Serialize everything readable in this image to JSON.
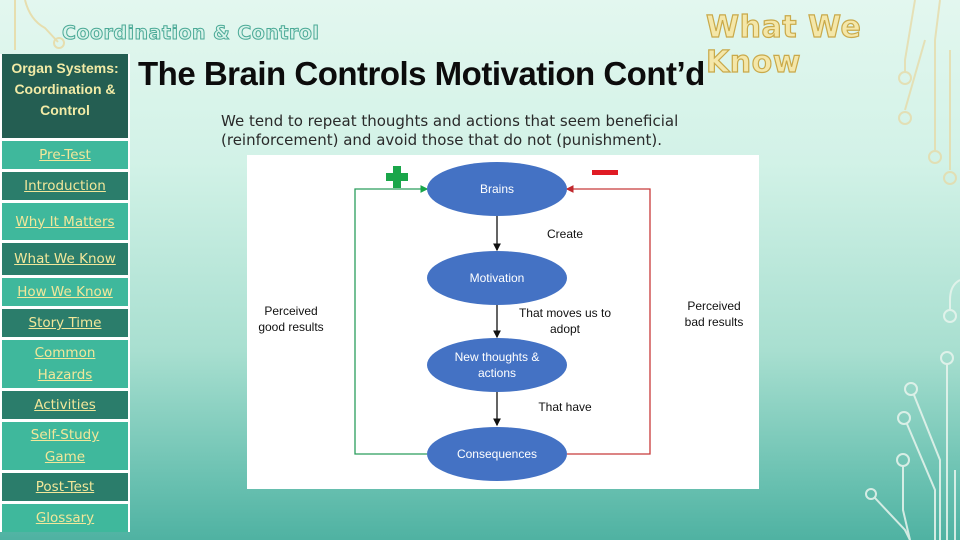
{
  "header": {
    "section_title": "Coordination & Control",
    "topic_title": "What We Know"
  },
  "sidebar": {
    "heading": "Organ Systems: Coordination & Control",
    "items": [
      {
        "label": "Pre-Test"
      },
      {
        "label": "Introduction"
      },
      {
        "label": "Why It Matters"
      },
      {
        "label": "What We Know"
      },
      {
        "label": "How We Know"
      },
      {
        "label": "Story Time"
      },
      {
        "label": "Common Hazards"
      },
      {
        "label": "Activities"
      },
      {
        "label": "Self-Study Game"
      },
      {
        "label": "Post-Test"
      },
      {
        "label": "Glossary"
      }
    ]
  },
  "main": {
    "title": "The Brain Controls Motivation Cont’d",
    "intro_line1": "We tend to repeat thoughts and actions that seem beneficial",
    "intro_line2": "(reinforcement) and avoid those that do not (punishment)."
  },
  "diagram": {
    "nodes": [
      {
        "label": "Brains"
      },
      {
        "label": "Motivation"
      },
      {
        "label": "New thoughts & actions"
      },
      {
        "label": "Consequences"
      }
    ],
    "edges": [
      {
        "label": "Create"
      },
      {
        "label": "That moves us to adopt"
      },
      {
        "label": "That have"
      }
    ],
    "left_loop": {
      "label": "Perceived good results",
      "symbol": "+",
      "color": "#1aa64a"
    },
    "right_loop": {
      "label": "Perceived bad results",
      "symbol": "−",
      "color": "#e01b24"
    },
    "node_color": "#4472c4"
  },
  "colors": {
    "sidebar_head": "#245e52",
    "sidebar_light": "#3fb89c",
    "sidebar_dark": "#2b7d6b",
    "link_text": "#f2e79a"
  }
}
